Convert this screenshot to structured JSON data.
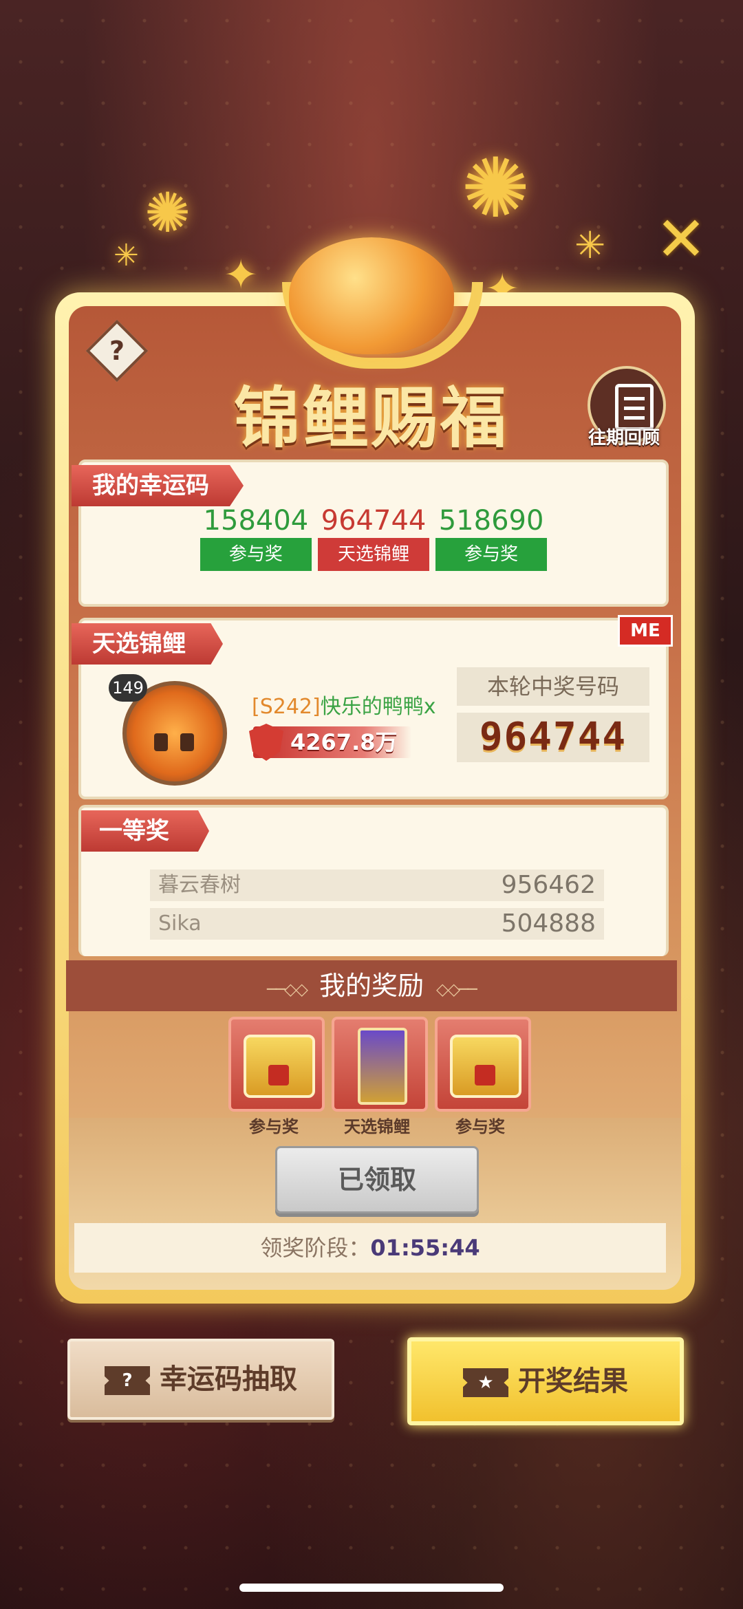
{
  "header": {
    "title": "锦鲤赐福",
    "history_label": "往期回顾",
    "help_icon": "question-diamond-icon",
    "close_icon": "close-x-icon"
  },
  "lucky_codes": {
    "tag": "我的幸运码",
    "codes": [
      {
        "number": "158404",
        "status": "参与奖",
        "color": "#27a13c"
      },
      {
        "number": "964744",
        "status": "天选锦鲤",
        "color": "#cf3b38"
      },
      {
        "number": "518690",
        "status": "参与奖",
        "color": "#27a13c"
      }
    ]
  },
  "chosen": {
    "tag": "天选锦鲤",
    "me_badge": "ME",
    "level": "149",
    "server": "[S242]",
    "player_name": "快乐的鸭鸭x",
    "power": "4267.8万",
    "winning_label": "本轮中奖号码",
    "winning_number": "964744"
  },
  "first_prize": {
    "tag": "一等奖",
    "rows": [
      {
        "name": "暮云春树",
        "code": "956462"
      },
      {
        "name": "Sika",
        "code": "504888"
      }
    ]
  },
  "rewards": {
    "title": "我的奖励",
    "items": [
      {
        "label": "参与奖",
        "icon": "dragon-chest-icon"
      },
      {
        "label": "天选锦鲤",
        "icon": "hero-card-icon"
      },
      {
        "label": "参与奖",
        "icon": "dragon-chest-icon"
      }
    ],
    "claimed_label": "已领取",
    "phase_label": "领奖阶段：",
    "phase_time": "01:55:44"
  },
  "buttons": {
    "lucky_draw": "幸运码抽取",
    "results": "开奖结果",
    "ticket_icon_q": "?",
    "ticket_icon_star": "★"
  }
}
